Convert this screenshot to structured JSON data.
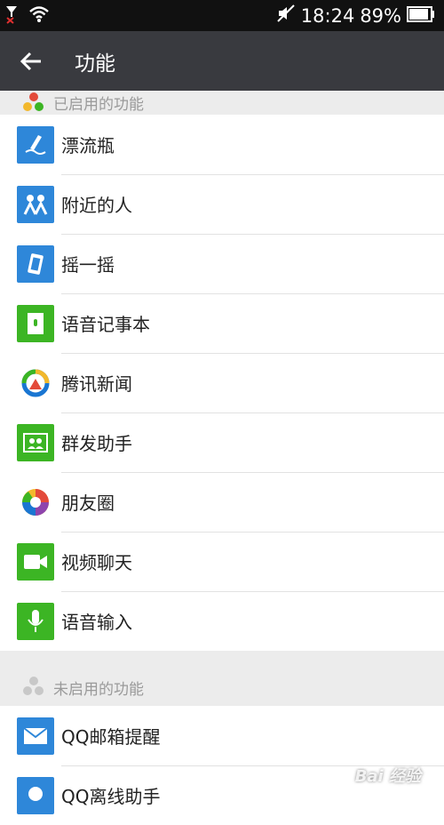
{
  "status_bar": {
    "time": "18:24",
    "battery": "89%"
  },
  "app_bar": {
    "title": "功能"
  },
  "enabled_section": {
    "title": "已启用的功能",
    "items": [
      {
        "label": "漂流瓶",
        "icon": "drift-bottle-icon",
        "color": "#2e87d9"
      },
      {
        "label": "附近的人",
        "icon": "people-nearby-icon",
        "color": "#2e87d9"
      },
      {
        "label": "摇一摇",
        "icon": "shake-icon",
        "color": "#2e87d9"
      },
      {
        "label": "语音记事本",
        "icon": "voice-notebook-icon",
        "color": "#3cb524"
      },
      {
        "label": "腾讯新闻",
        "icon": "tencent-news-icon",
        "color": "#ffffff"
      },
      {
        "label": "群发助手",
        "icon": "broadcast-assistant-icon",
        "color": "#3cb524"
      },
      {
        "label": "朋友圈",
        "icon": "moments-icon",
        "color": "#ffffff"
      },
      {
        "label": "视频聊天",
        "icon": "video-chat-icon",
        "color": "#3cb524"
      },
      {
        "label": "语音输入",
        "icon": "voice-input-icon",
        "color": "#3cb524"
      }
    ]
  },
  "disabled_section": {
    "title": "未启用的功能",
    "items": [
      {
        "label": "QQ邮箱提醒",
        "icon": "mail-icon",
        "color": "#2e87d9"
      },
      {
        "label": "QQ离线助手",
        "icon": "qq-offline-icon",
        "color": "#2e87d9"
      }
    ]
  },
  "watermark": "Bai 经验"
}
